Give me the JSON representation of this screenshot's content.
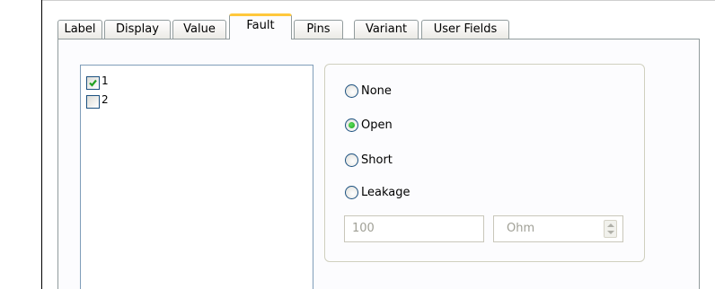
{
  "tabs": [
    "Label",
    "Display",
    "Value",
    "Fault",
    "Pins",
    "Variant",
    "User Fields"
  ],
  "active_tab": "Fault",
  "pins": [
    {
      "label": "1",
      "checked": true
    },
    {
      "label": "2",
      "checked": false
    }
  ],
  "fault_options": [
    {
      "label": "None",
      "selected": false
    },
    {
      "label": "Open",
      "selected": true
    },
    {
      "label": "Short",
      "selected": false
    },
    {
      "label": "Leakage",
      "selected": false
    }
  ],
  "leakage": {
    "value": "100",
    "unit": "Ohm"
  },
  "colors": {
    "active_tab_accent": "#ffc83c",
    "check_mark": "#21a121",
    "radio_dot": "#21a121"
  }
}
